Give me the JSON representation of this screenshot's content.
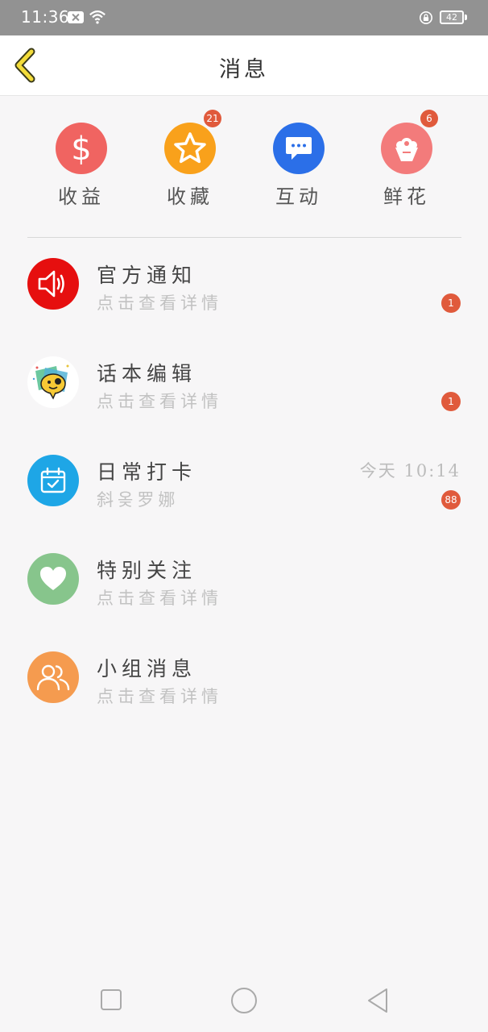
{
  "status_bar": {
    "time": "11:36",
    "battery": "42"
  },
  "header": {
    "title": "消息",
    "back_icon": "chevron-left-icon"
  },
  "categories": [
    {
      "label": "收益",
      "icon": "dollar-icon",
      "color": "#f06461",
      "badge": ""
    },
    {
      "label": "收藏",
      "icon": "star-icon",
      "color": "#f9a11b",
      "badge": "21"
    },
    {
      "label": "互动",
      "icon": "chat-bubble-icon",
      "color": "#2b6fe8",
      "badge": ""
    },
    {
      "label": "鲜花",
      "icon": "flower-icon",
      "color": "#f37b7b",
      "badge": "6"
    }
  ],
  "messages": [
    {
      "title": "官方通知",
      "subtitle": "点击查看详情",
      "time": "",
      "badge": "1",
      "icon": "speaker-icon",
      "color": "#e60f0f"
    },
    {
      "title": "话本编辑",
      "subtitle": "点击查看详情",
      "time": "",
      "badge": "1",
      "icon": "editor-avatar-icon",
      "color": "#ffffff"
    },
    {
      "title": "日常打卡",
      "subtitle": "斜옺罗娜",
      "time": "今天 10:14",
      "badge": "88",
      "icon": "calendar-check-icon",
      "color": "#1ea6e6"
    },
    {
      "title": "特别关注",
      "subtitle": "点击查看详情",
      "time": "",
      "badge": "",
      "icon": "heart-icon",
      "color": "#87c58c"
    },
    {
      "title": "小组消息",
      "subtitle": "点击查看详情",
      "time": "",
      "badge": "",
      "icon": "group-icon",
      "color": "#f59b4f"
    }
  ],
  "system_nav": {
    "recent_icon": "square-icon",
    "home_icon": "circle-icon",
    "back_icon": "triangle-back-icon"
  }
}
